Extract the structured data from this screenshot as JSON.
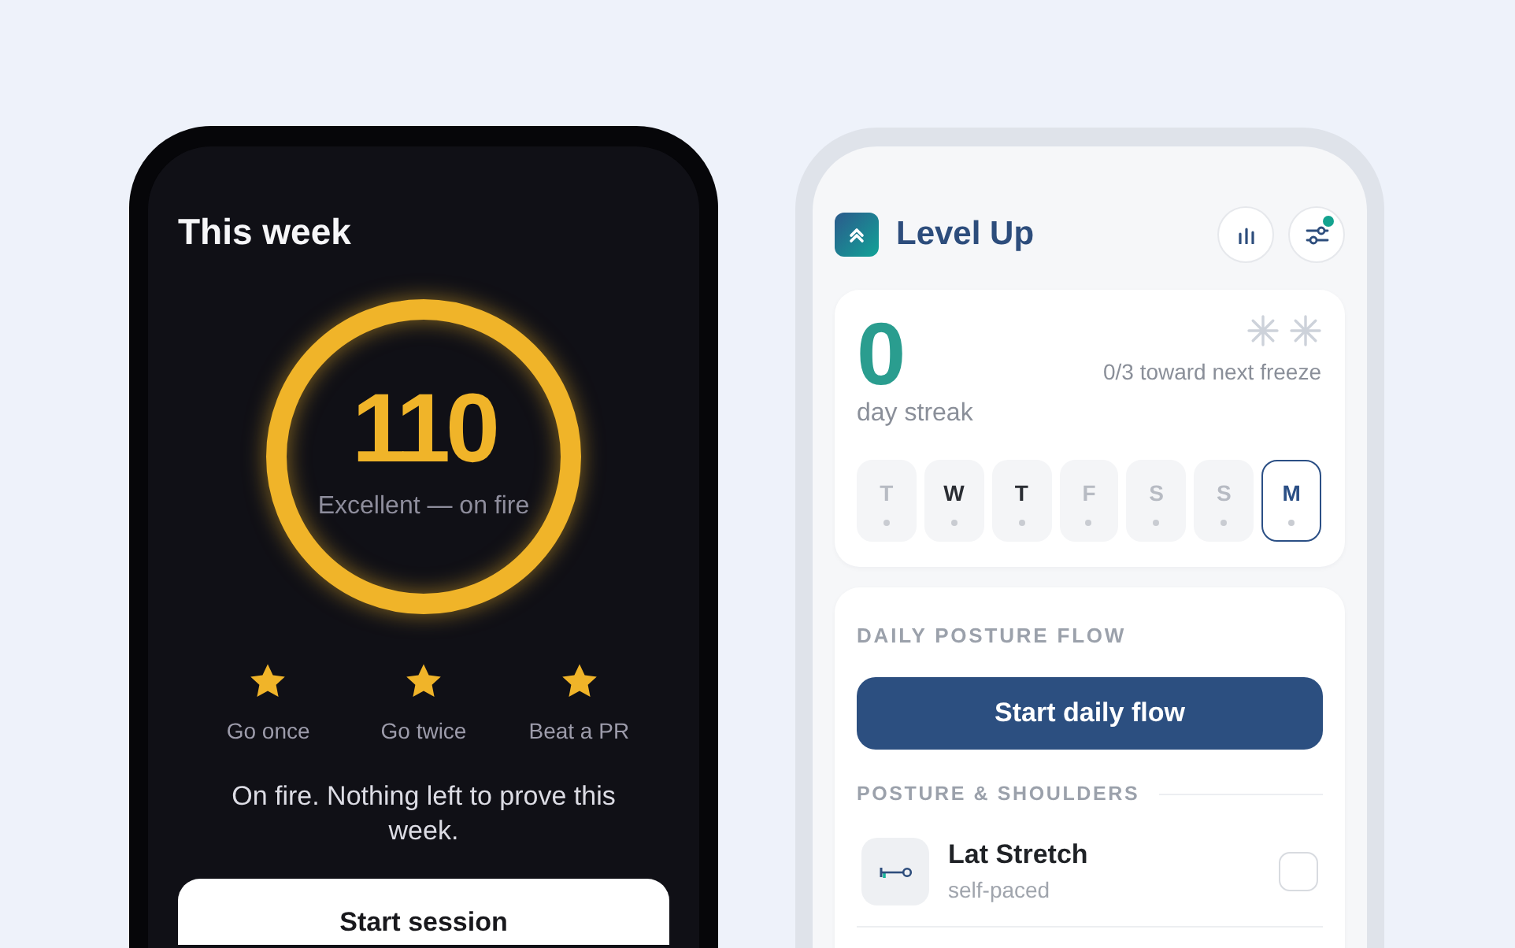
{
  "left_phone": {
    "title": "This week",
    "score": {
      "value": "110",
      "caption": "Excellent — on fire",
      "level": 1
    },
    "goals": [
      {
        "label": "Go once",
        "achieved": true
      },
      {
        "label": "Go twice",
        "achieved": true
      },
      {
        "label": "Beat a PR",
        "achieved": true
      }
    ],
    "message": "On fire. Nothing left to prove this week.",
    "button": "Start session"
  },
  "right_phone": {
    "app_name": "Level Up",
    "header_buttons": [
      {
        "kind": "stats"
      },
      {
        "kind": "settings",
        "notification": true
      }
    ],
    "streak": {
      "count": "0",
      "label": "day streak",
      "freezes": [
        {
          "earned": false
        },
        {
          "earned": false
        }
      ],
      "freeze_progress": "0/3 toward next freeze"
    },
    "days": [
      {
        "letter": "T",
        "done": false,
        "selected": false
      },
      {
        "letter": "W",
        "done": true,
        "selected": false
      },
      {
        "letter": "T",
        "done": true,
        "selected": false
      },
      {
        "letter": "F",
        "done": false,
        "selected": false
      },
      {
        "letter": "S",
        "done": false,
        "selected": false
      },
      {
        "letter": "S",
        "done": false,
        "selected": false
      },
      {
        "letter": "M",
        "done": false,
        "selected": true
      }
    ],
    "daily_flow": {
      "heading": "DAILY POSTURE FLOW",
      "button": "Start daily flow",
      "section": "POSTURE & SHOULDERS",
      "exercises": [
        {
          "name": "Lat Stretch",
          "detail": "self-paced",
          "checked": false
        }
      ]
    }
  }
}
